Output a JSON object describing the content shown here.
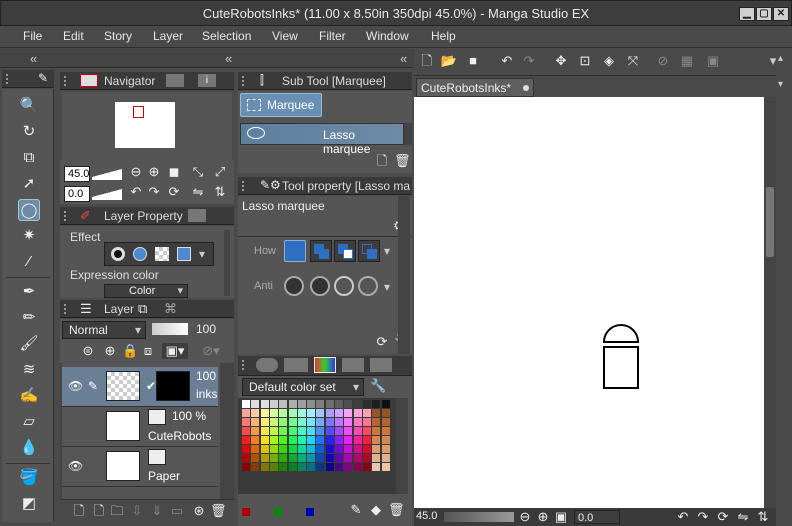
{
  "window": {
    "title": "CuteRobotsInks* (11.00 x 8.50in 350dpi 45.0%)  - Manga Studio EX"
  },
  "menu": [
    "File",
    "Edit",
    "Story",
    "Layer",
    "Selection",
    "View",
    "Filter",
    "Window",
    "Help"
  ],
  "navigator": {
    "title": "Navigator",
    "zoom": "45.0",
    "rotation": "0.0"
  },
  "layer_property": {
    "title": "Layer Property",
    "effect_label": "Effect",
    "expression_label": "Expression color",
    "color_value": "Color"
  },
  "layer_panel": {
    "title": "Layer",
    "blend_mode": "Normal",
    "opacity": "100",
    "layers": [
      {
        "percent": "100",
        "name": "inks"
      },
      {
        "percent": "100 %",
        "name": "CuteRobots"
      },
      {
        "percent": "",
        "name": "Paper"
      }
    ]
  },
  "sub_tool": {
    "title": "Sub Tool [Marquee]",
    "group": "Marquee",
    "item": "Lasso marquee"
  },
  "tool_property": {
    "title": "Tool property [Lasso ma",
    "name": "Lasso marquee",
    "how_label": "How",
    "anti_label": "Anti"
  },
  "color_set": {
    "name": "Default color set"
  },
  "document_tab": {
    "label": "CuteRobotsInks*"
  },
  "status": {
    "zoom": "45.0",
    "rotation": "0.0"
  },
  "colors": {
    "accent": "#4c78a8",
    "panel": "#555555",
    "titlebar": "#3d3d3d"
  }
}
